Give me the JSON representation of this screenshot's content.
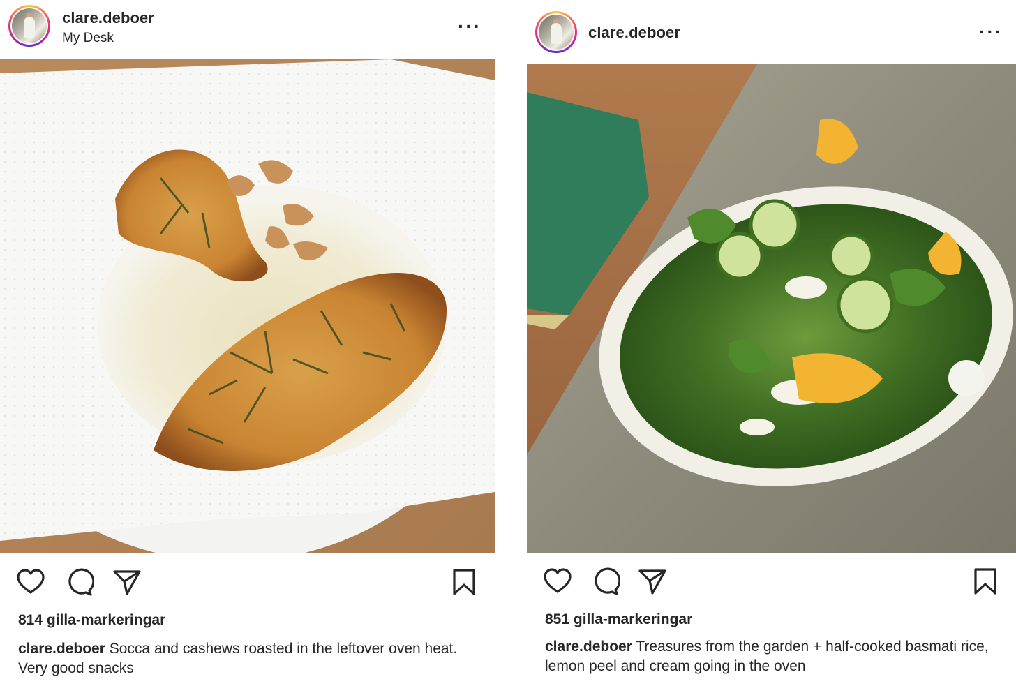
{
  "posts": [
    {
      "username": "clare.deboer",
      "location": "My Desk",
      "likes": "814 gilla-markeringar",
      "caption_user": "clare.deboer",
      "caption_text": "Socca and cashews roasted in the leftover oven heat. Very good snacks",
      "image": "socca-cashews-photo"
    },
    {
      "username": "clare.deboer",
      "likes": "851 gilla-markeringar",
      "caption_user": "clare.deboer",
      "caption_text": "Treasures from the garden + half-cooked basmati rice, lemon peel and cream going in the oven",
      "image": "garden-salad-photo"
    }
  ],
  "icons": {
    "more": "more-options-icon",
    "like": "heart-icon",
    "comment": "comment-icon",
    "share": "share-icon",
    "save": "bookmark-icon"
  },
  "colors": {
    "text": "#262626",
    "avatar_ring": [
      "#f9ce34",
      "#ee2a7b",
      "#6228d7"
    ]
  }
}
